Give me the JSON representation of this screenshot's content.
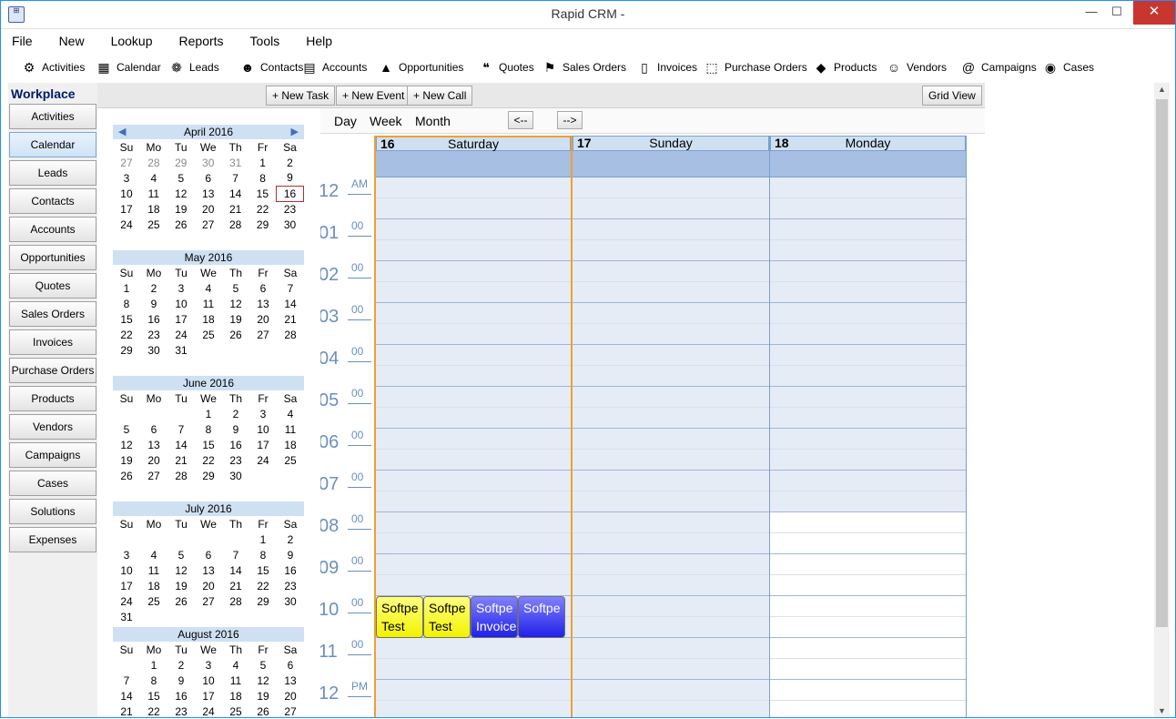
{
  "window": {
    "title": "Rapid CRM -",
    "minimize": "—",
    "maximize": "☐",
    "close": "✕",
    "app_icon": "⊞"
  },
  "menu": [
    "File",
    "New",
    "Lookup",
    "Reports",
    "Tools",
    "Help"
  ],
  "toolbar": [
    {
      "label": "Activities",
      "icon": "activities-icon",
      "glyph": "⚙"
    },
    {
      "label": "Calendar",
      "icon": "calendar-icon",
      "glyph": "▦"
    },
    {
      "label": "Leads",
      "icon": "leads-icon",
      "glyph": "❁"
    },
    {
      "label": "Contacts",
      "icon": "contacts-icon",
      "glyph": "☻"
    },
    {
      "label": "Accounts",
      "icon": "accounts-icon",
      "glyph": "▤"
    },
    {
      "label": "Opportunities",
      "icon": "opportunities-icon",
      "glyph": "▲"
    },
    {
      "label": "Quotes",
      "icon": "quotes-icon",
      "glyph": "❝"
    },
    {
      "label": "Sales Orders",
      "icon": "sales-orders-icon",
      "glyph": "⚑"
    },
    {
      "label": "Invoices",
      "icon": "invoices-icon",
      "glyph": "▯"
    },
    {
      "label": "Purchase Orders",
      "icon": "purchase-orders-icon",
      "glyph": "⬚"
    },
    {
      "label": "Products",
      "icon": "products-icon",
      "glyph": "◆"
    },
    {
      "label": "Vendors",
      "icon": "vendors-icon",
      "glyph": "☺"
    },
    {
      "label": "Campaigns",
      "icon": "campaigns-icon",
      "glyph": "@"
    },
    {
      "label": "Cases",
      "icon": "cases-icon",
      "glyph": "◉"
    }
  ],
  "sidebar": {
    "header": "Workplace",
    "items": [
      "Activities",
      "Calendar",
      "Leads",
      "Contacts",
      "Accounts",
      "Opportunities",
      "Quotes",
      "Sales Orders",
      "Invoices",
      "Purchase Orders",
      "Products",
      "Vendors",
      "Campaigns",
      "Cases",
      "Solutions",
      "Expenses"
    ],
    "active": "Calendar"
  },
  "actions": {
    "new_task": "+ New Task",
    "new_event": "+ New Event",
    "new_call": "+ New Call",
    "grid_view": "Grid View"
  },
  "views": {
    "day": "Day",
    "week": "Week",
    "month": "Month",
    "prev": "<--",
    "next": "-->"
  },
  "mini_calendars": [
    {
      "title": "April 2016",
      "weeks": [
        [
          "27",
          "28",
          "29",
          "30",
          "31",
          "1",
          "2"
        ],
        [
          "3",
          "4",
          "5",
          "6",
          "7",
          "8",
          "9"
        ],
        [
          "10",
          "11",
          "12",
          "13",
          "14",
          "15",
          "16"
        ],
        [
          "17",
          "18",
          "19",
          "20",
          "21",
          "22",
          "23"
        ],
        [
          "24",
          "25",
          "26",
          "27",
          "28",
          "29",
          "30"
        ]
      ],
      "dim_first": 5,
      "today": "16",
      "nav": true
    },
    {
      "title": "May 2016",
      "weeks": [
        [
          "1",
          "2",
          "3",
          "4",
          "5",
          "6",
          "7"
        ],
        [
          "8",
          "9",
          "10",
          "11",
          "12",
          "13",
          "14"
        ],
        [
          "15",
          "16",
          "17",
          "18",
          "19",
          "20",
          "21"
        ],
        [
          "22",
          "23",
          "24",
          "25",
          "26",
          "27",
          "28"
        ],
        [
          "29",
          "30",
          "31",
          "",
          "",
          "",
          ""
        ]
      ]
    },
    {
      "title": "June 2016",
      "weeks": [
        [
          "",
          "",
          "",
          "1",
          "2",
          "3",
          "4"
        ],
        [
          "5",
          "6",
          "7",
          "8",
          "9",
          "10",
          "11"
        ],
        [
          "12",
          "13",
          "14",
          "15",
          "16",
          "17",
          "18"
        ],
        [
          "19",
          "20",
          "21",
          "22",
          "23",
          "24",
          "25"
        ],
        [
          "26",
          "27",
          "28",
          "29",
          "30",
          "",
          ""
        ]
      ]
    },
    {
      "title": "July 2016",
      "weeks": [
        [
          "",
          "",
          "",
          "",
          "",
          "1",
          "2"
        ],
        [
          "3",
          "4",
          "5",
          "6",
          "7",
          "8",
          "9"
        ],
        [
          "10",
          "11",
          "12",
          "13",
          "14",
          "15",
          "16"
        ],
        [
          "17",
          "18",
          "19",
          "20",
          "21",
          "22",
          "23"
        ],
        [
          "24",
          "25",
          "26",
          "27",
          "28",
          "29",
          "30"
        ],
        [
          "31",
          "",
          "",
          "",
          "",
          "",
          ""
        ]
      ]
    },
    {
      "title": "August 2016",
      "weeks": [
        [
          "",
          "1",
          "2",
          "3",
          "4",
          "5",
          "6"
        ],
        [
          "7",
          "8",
          "9",
          "10",
          "11",
          "12",
          "13"
        ],
        [
          "14",
          "15",
          "16",
          "17",
          "18",
          "19",
          "20"
        ],
        [
          "21",
          "22",
          "23",
          "24",
          "25",
          "26",
          "27"
        ]
      ]
    }
  ],
  "weekday_headers": [
    "Su",
    "Mo",
    "Tu",
    "We",
    "Th",
    "Fr",
    "Sa"
  ],
  "day_columns": [
    {
      "num": "16",
      "name": "Saturday",
      "weekend": true,
      "today": true
    },
    {
      "num": "17",
      "name": "Sunday",
      "weekend": true
    },
    {
      "num": "18",
      "name": "Monday",
      "weekend": false
    }
  ],
  "hours": [
    {
      "h": "12",
      "m": "AM"
    },
    {
      "h": "01",
      "m": "00"
    },
    {
      "h": "02",
      "m": "00"
    },
    {
      "h": "03",
      "m": "00"
    },
    {
      "h": "04",
      "m": "00"
    },
    {
      "h": "05",
      "m": "00"
    },
    {
      "h": "06",
      "m": "00"
    },
    {
      "h": "07",
      "m": "00"
    },
    {
      "h": "08",
      "m": "00"
    },
    {
      "h": "09",
      "m": "00"
    },
    {
      "h": "10",
      "m": "00"
    },
    {
      "h": "11",
      "m": "00"
    },
    {
      "h": "12",
      "m": "PM"
    }
  ],
  "appointments": [
    {
      "line1": "Softpe",
      "line2": "Test",
      "style": "yellow"
    },
    {
      "line1": "Softpe",
      "line2": "Test",
      "style": "yellow"
    },
    {
      "line1": "Softpe",
      "line2": "Invoice",
      "style": "blue"
    },
    {
      "line1": "Softpe",
      "line2": "",
      "style": "blue"
    }
  ],
  "colors": {
    "accent": "#1e90ff",
    "weekend_bg": "#e6ecf5",
    "header_bg": "#cfe0f3",
    "allday_bg": "#a7bfe2",
    "today_border": "#f0a030"
  }
}
